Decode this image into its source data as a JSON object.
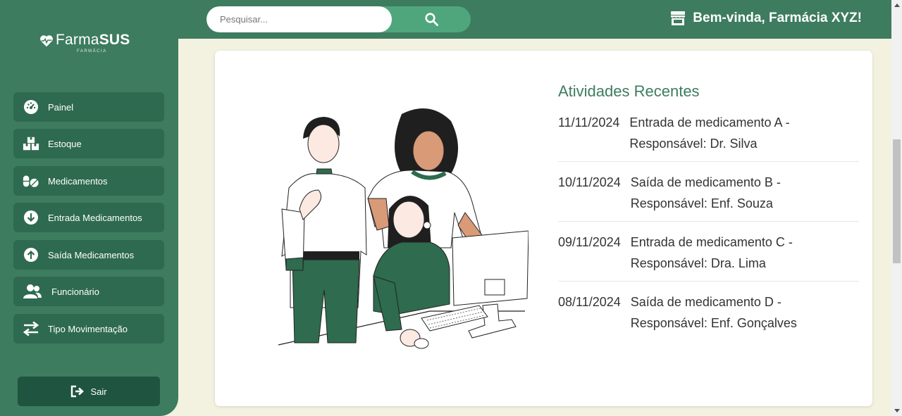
{
  "brand": {
    "name_light": "Farma",
    "name_bold": "SUS",
    "subtitle": "FARMÁCIA"
  },
  "sidebar": {
    "items": [
      {
        "label": "Painel",
        "icon": "dashboard-icon"
      },
      {
        "label": "Estoque",
        "icon": "boxes-icon"
      },
      {
        "label": "Medicamentos",
        "icon": "pills-icon"
      },
      {
        "label": "Entrada Medicamentos",
        "icon": "arrow-circle-down-icon"
      },
      {
        "label": "Saída Medicamentos",
        "icon": "arrow-circle-up-icon"
      },
      {
        "label": "Funcionário",
        "icon": "users-icon"
      },
      {
        "label": "Tipo Movimentação",
        "icon": "exchange-icon"
      }
    ],
    "logout_label": "Sair"
  },
  "header": {
    "search_placeholder": "Pesquisar...",
    "welcome": "Bem-vinda, Farmácia XYZ!"
  },
  "activities": {
    "title": "Atividades Recentes",
    "items": [
      {
        "date": "11/11/2024",
        "text": "Entrada de medicamento A - Responsável: Dr. Silva"
      },
      {
        "date": "10/11/2024",
        "text": "Saída de medicamento B - Responsável: Enf. Souza"
      },
      {
        "date": "09/11/2024",
        "text": "Entrada de medicamento C - Responsável: Dra. Lima"
      },
      {
        "date": "08/11/2024",
        "text": "Saída de medicamento D - Responsável: Enf. Gonçalves"
      }
    ]
  },
  "colors": {
    "primary": "#3d7c5f",
    "nav_item": "#2e6a4f",
    "logout": "#1e5440",
    "search_button": "#4fa67d",
    "background": "#f3f1e0"
  }
}
